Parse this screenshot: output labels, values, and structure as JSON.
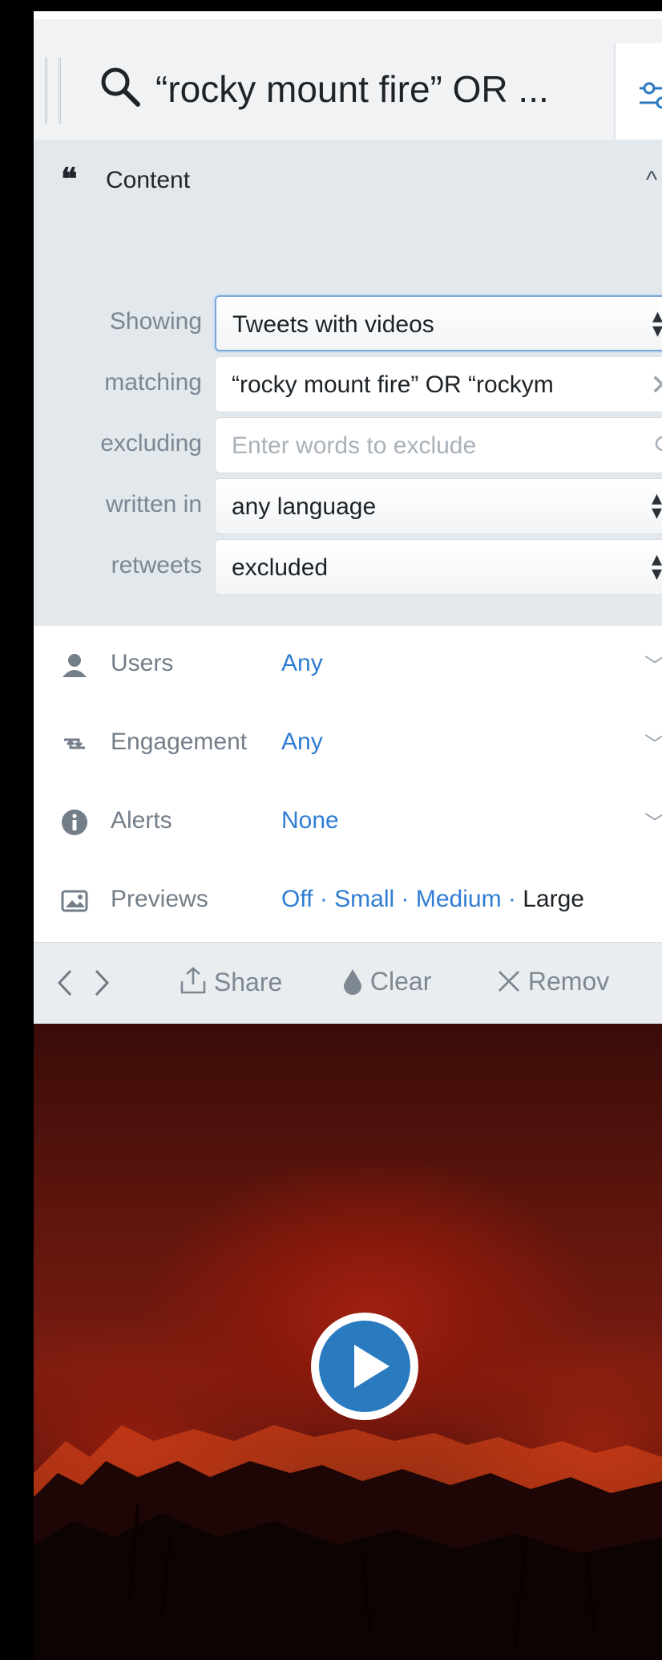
{
  "column": {
    "number": "3"
  },
  "header": {
    "title": "“rocky mount fire” OR ..."
  },
  "content": {
    "section_label": "Content",
    "rows": [
      {
        "label": "Showing",
        "value": "Tweets with videos"
      },
      {
        "label": "matching",
        "value": "“rocky mount fire” OR “rockym"
      },
      {
        "label": "excluding",
        "placeholder": "Enter words to exclude"
      },
      {
        "label": "written in",
        "value": "any language"
      },
      {
        "label": "retweets",
        "value": "excluded"
      }
    ]
  },
  "sections": {
    "users": {
      "label": "Users",
      "value": "Any"
    },
    "engagement": {
      "label": "Engagement",
      "value": "Any"
    },
    "alerts": {
      "label": "Alerts",
      "value": "None"
    },
    "previews": {
      "label": "Previews",
      "options": [
        "Off",
        "Small",
        "Medium",
        "Large"
      ],
      "separator": "·",
      "selected": "Large"
    }
  },
  "toolbar": {
    "share": "Share",
    "clear": "Clear",
    "remove": "Remov"
  },
  "colors": {
    "accent": "#2f7dd3",
    "play": "#2a7ac0"
  }
}
